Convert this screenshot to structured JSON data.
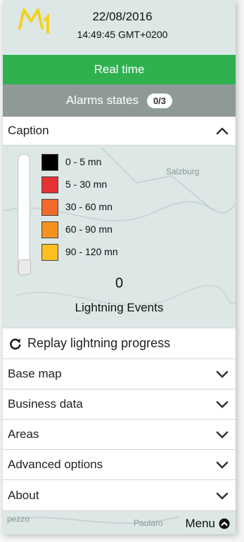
{
  "header": {
    "date": "22/08/2016",
    "time": "14:49:45 GMT+0200"
  },
  "realtime_label": "Real time",
  "alarms": {
    "label": "Alarms states",
    "badge": "0/3"
  },
  "caption": {
    "title": "Caption",
    "legend": [
      {
        "label": "0 - 5 mn",
        "color": "#000000"
      },
      {
        "label": "5 - 30 mn",
        "color": "#e53234"
      },
      {
        "label": "30 - 60 mn",
        "color": "#f06a2c"
      },
      {
        "label": "60 - 90 mn",
        "color": "#f5921f"
      },
      {
        "label": "90 - 120 mn",
        "color": "#fbbf22"
      }
    ],
    "event_count": "0",
    "event_label": "Lightning Events"
  },
  "replay_label": "Replay lightning progress",
  "sections": [
    {
      "label": "Base map"
    },
    {
      "label": "Business data"
    },
    {
      "label": "Areas"
    },
    {
      "label": "Advanced options"
    },
    {
      "label": "About"
    }
  ],
  "menu_label": "Menu",
  "map_labels": [
    "Salzburg",
    "pezzo",
    "Paularo"
  ],
  "colors": {
    "realtime_bg": "#2fb150",
    "alarms_bg": "#8f9a98",
    "logo_yellow": "#f2d21c"
  }
}
